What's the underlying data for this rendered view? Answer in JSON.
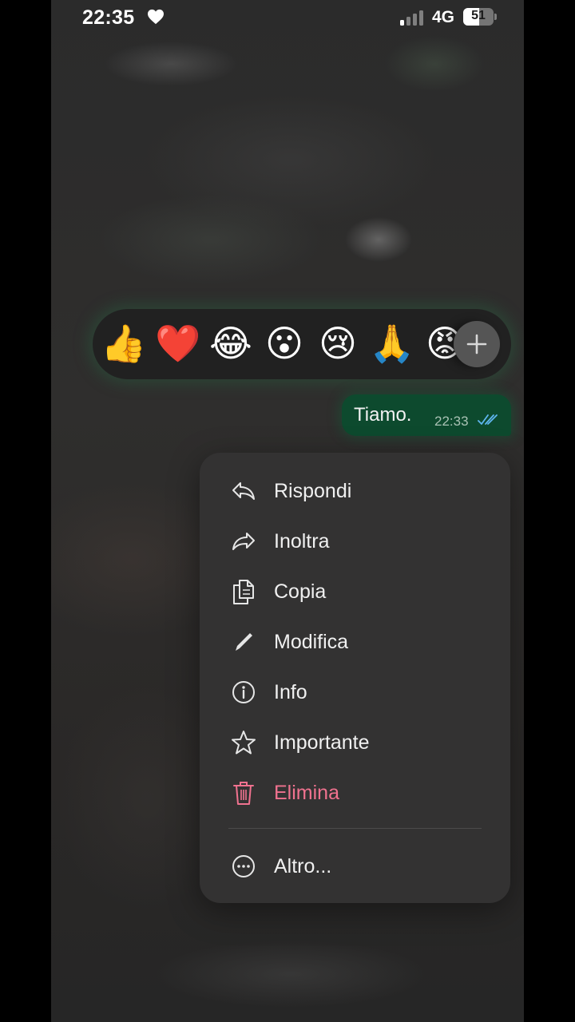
{
  "status_bar": {
    "time": "22:35",
    "network": "4G",
    "battery": "51"
  },
  "reactions": {
    "emojis": [
      "👍",
      "❤️",
      "😂",
      "😮",
      "😢",
      "🙏",
      "😡"
    ],
    "more_icon": "plus-icon"
  },
  "message": {
    "text": "Tiamo.",
    "time": "22:33",
    "status": "read",
    "tick_color": "#5fb6f0"
  },
  "menu": {
    "items": [
      {
        "label": "Rispondi",
        "icon": "reply-icon"
      },
      {
        "label": "Inoltra",
        "icon": "forward-icon"
      },
      {
        "label": "Copia",
        "icon": "copy-icon"
      },
      {
        "label": "Modifica",
        "icon": "edit-icon"
      },
      {
        "label": "Info",
        "icon": "info-icon"
      },
      {
        "label": "Importante",
        "icon": "star-icon"
      },
      {
        "label": "Elimina",
        "icon": "trash-icon",
        "color": "#f0728f"
      }
    ],
    "more": {
      "label": "Altro...",
      "icon": "more-icon"
    }
  },
  "colors": {
    "bubble": "#0d4a2e",
    "menu_bg": "#333232",
    "danger": "#f0728f"
  }
}
